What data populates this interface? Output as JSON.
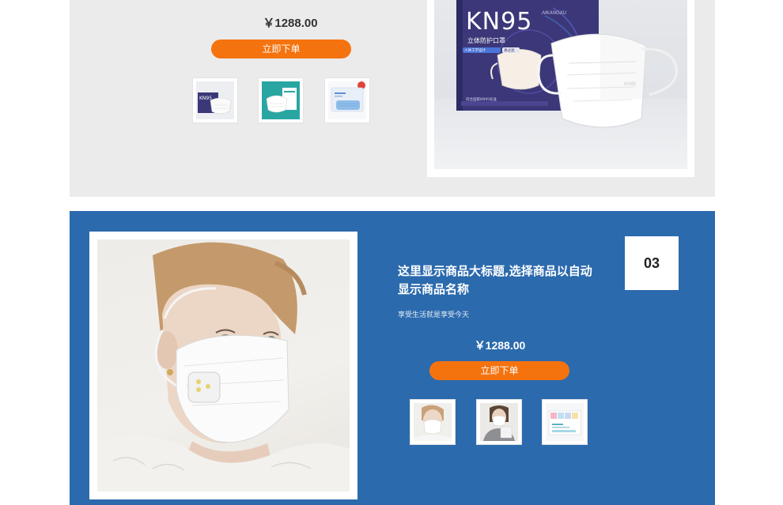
{
  "section1": {
    "price": "￥1288.00",
    "order_button": "立即下单",
    "thumbnails": [
      {
        "name": "thumb-kn95-box"
      },
      {
        "name": "thumb-teal-mask-box"
      },
      {
        "name": "thumb-blue-mask-pack"
      }
    ],
    "main_image": {
      "brand": "KN95",
      "brand_sub": "AIKANGXU",
      "box_caption": "立体防护口罩",
      "box_badge": "人体工学设计",
      "box_badge2": "真过滤",
      "box_footer": "符合国家KN95标准",
      "mask_print": "KN95"
    }
  },
  "section2": {
    "title": "这里显示商品大标题,选择商品以自动显示商品名称",
    "subtitle": "享受生活就是享受今天",
    "price": "￥1288.00",
    "order_button": "立即下单",
    "index": "03",
    "thumbnails": [
      {
        "name": "thumb-woman-mask"
      },
      {
        "name": "thumb-woman-holding-mask"
      },
      {
        "name": "thumb-colored-mask-box"
      }
    ]
  },
  "colors": {
    "accent": "#f5730f",
    "blue_section": "#2b6aad",
    "grey_section": "#ebebeb",
    "box_navy": "#3b3778"
  }
}
